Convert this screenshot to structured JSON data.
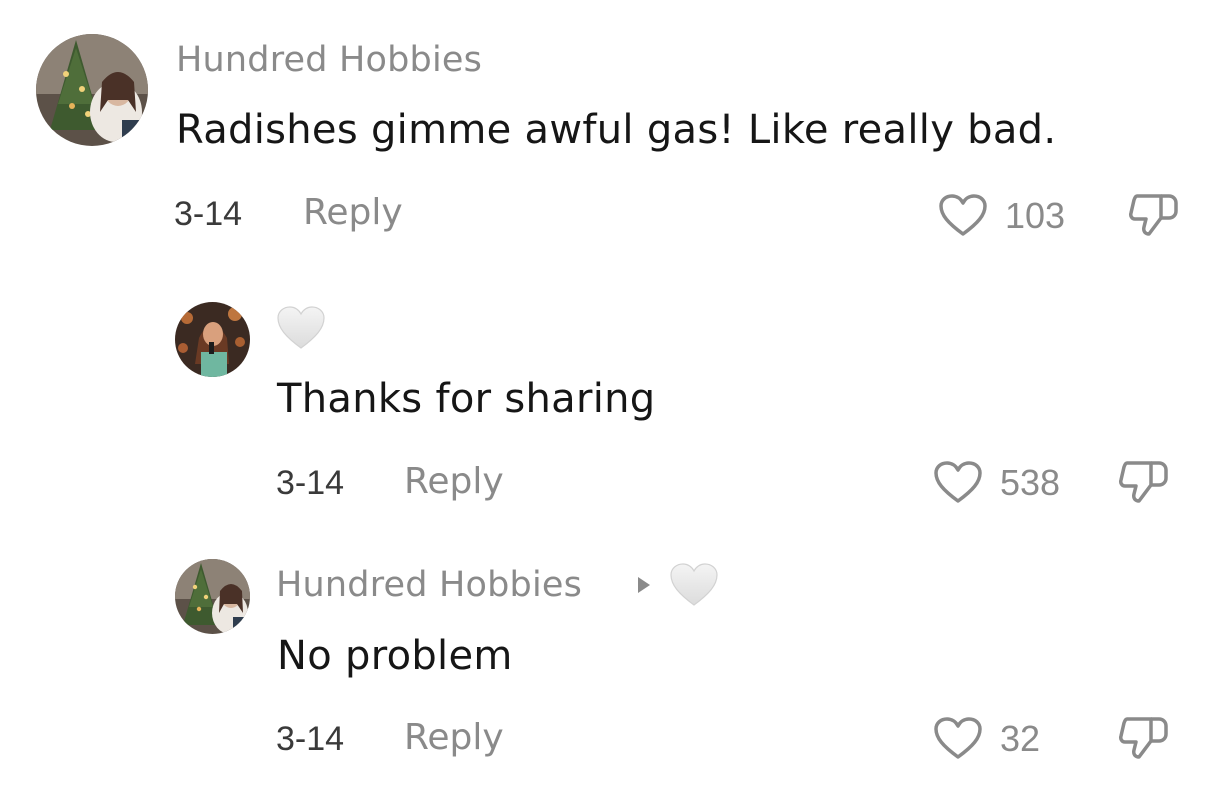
{
  "comments": [
    {
      "username": "Hundred Hobbies",
      "text": "Radishes gimme awful gas! Like really bad.",
      "date": "3-14",
      "reply_label": "Reply",
      "likes": "103"
    },
    {
      "username": "",
      "text": "Thanks for sharing",
      "date": "3-14",
      "reply_label": "Reply",
      "likes": "538",
      "creator_liked_icon": "white-heart-icon"
    },
    {
      "username": "Hundred Hobbies",
      "reply_to_arrow_icon": "caret-right-icon",
      "text": "No problem",
      "date": "3-14",
      "reply_label": "Reply",
      "likes": "32",
      "creator_liked_icon": "white-heart-icon"
    }
  ],
  "icons": {
    "like": "heart-outline-icon",
    "dislike": "thumbs-down-icon"
  },
  "colors": {
    "secondary_text": "#8a8a8a",
    "primary_text": "#161616",
    "background": "#ffffff"
  }
}
